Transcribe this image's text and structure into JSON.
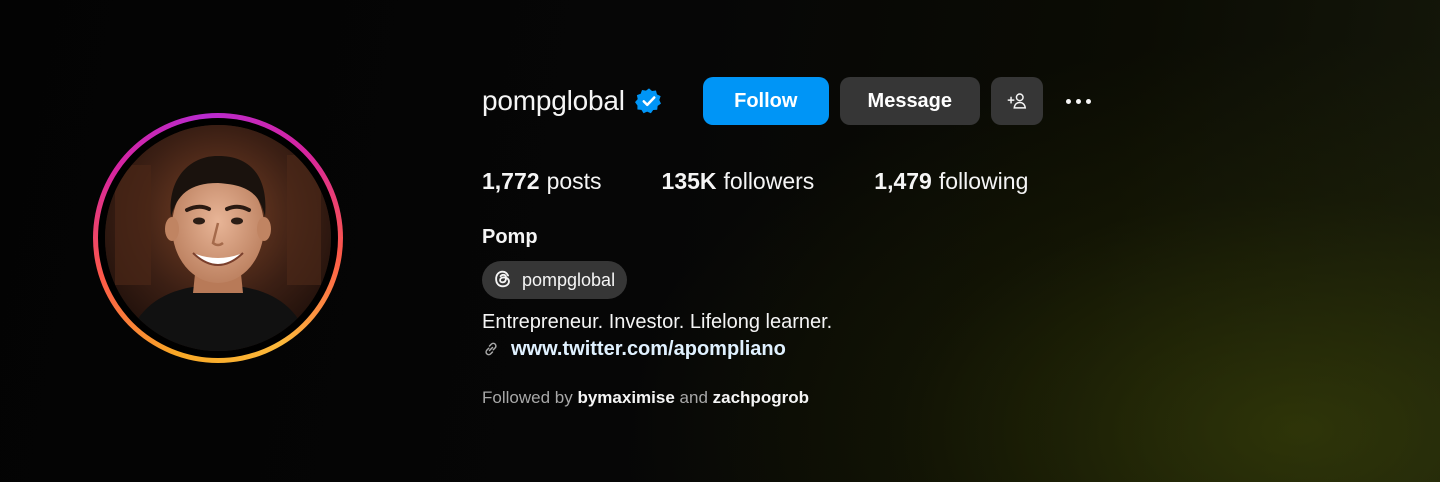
{
  "profile": {
    "username": "pompglobal",
    "verified": true,
    "full_name": "Pomp",
    "threads_handle": "pompglobal",
    "bio": "Entrepreneur. Investor. Lifelong learner.",
    "link": "www.twitter.com/apompliano"
  },
  "actions": {
    "follow_label": "Follow",
    "message_label": "Message",
    "add_user_icon": "person-plus-icon",
    "more_icon": "more-options-icon"
  },
  "stats": {
    "posts_count": "1,772",
    "posts_label": "posts",
    "followers_count": "135K",
    "followers_label": "followers",
    "following_count": "1,479",
    "following_label": "following"
  },
  "followed_by": {
    "prefix": "Followed by",
    "users": [
      "bymaximise",
      "zachpogrob"
    ],
    "conjunction": "and"
  },
  "colors": {
    "follow_button": "#0095f6",
    "secondary_button": "#363636",
    "verified_badge": "#0095f6",
    "link": "#e0f1ff"
  }
}
